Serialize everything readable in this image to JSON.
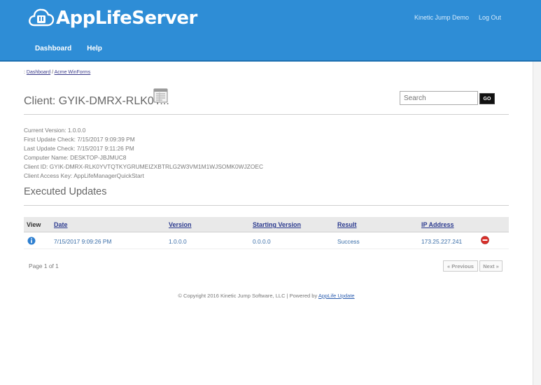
{
  "header": {
    "logo_text": "AppLifeServer",
    "user_name": "Kinetic Jump Demo",
    "logout_label": "Log Out",
    "nav": [
      {
        "label": "Dashboard"
      },
      {
        "label": "Help"
      }
    ]
  },
  "breadcrumb": {
    "prefix": ": ",
    "items": [
      "Dashboard",
      "Acme WinForms"
    ],
    "separator": " / "
  },
  "client": {
    "title": "Client: GYIK-DMRX-RLK0Y...",
    "search_placeholder": "Search",
    "go_label": "GO"
  },
  "info": {
    "current_version": "Current Version: 1.0.0.0",
    "first_update_check": "First Update Check: 7/15/2017 9:09:39 PM",
    "last_update_check": "Last Update Check: 7/15/2017 9:11:26 PM",
    "computer_name": "Computer Name: DESKTOP-JBJMUC8",
    "client_id": "Client ID: GYIK-DMRX-RLK0YVTQTKYGRUMEIZXBTRLG2W3VM1M1WJSOMK0WJZOEC",
    "client_access_key": "Client Access Key: AppLifeManagerQuickStart"
  },
  "updates": {
    "title": "Executed Updates",
    "columns": {
      "view": "View",
      "date": "Date",
      "version": "Version",
      "starting_version": "Starting Version",
      "result": "Result",
      "ip_address": "IP Address"
    },
    "rows": [
      {
        "date": "7/15/2017 9:09:26 PM",
        "version": "1.0.0.0",
        "starting_version": "0.0.0.0",
        "result": "Success",
        "ip_address": "173.25.227.241"
      }
    ]
  },
  "pager": {
    "text": "Page 1 of 1",
    "previous_label": "« Previous",
    "next_label": "Next »"
  },
  "footer": {
    "text": "© Copyright 2016 Kinetic Jump Software, LLC | Powered by ",
    "link": "AppLife Update"
  },
  "colors": {
    "header_bg": "#2e8dd6",
    "link": "#2b3a8f",
    "info_icon": "#2e7fd0",
    "delete_icon": "#d9302b"
  }
}
